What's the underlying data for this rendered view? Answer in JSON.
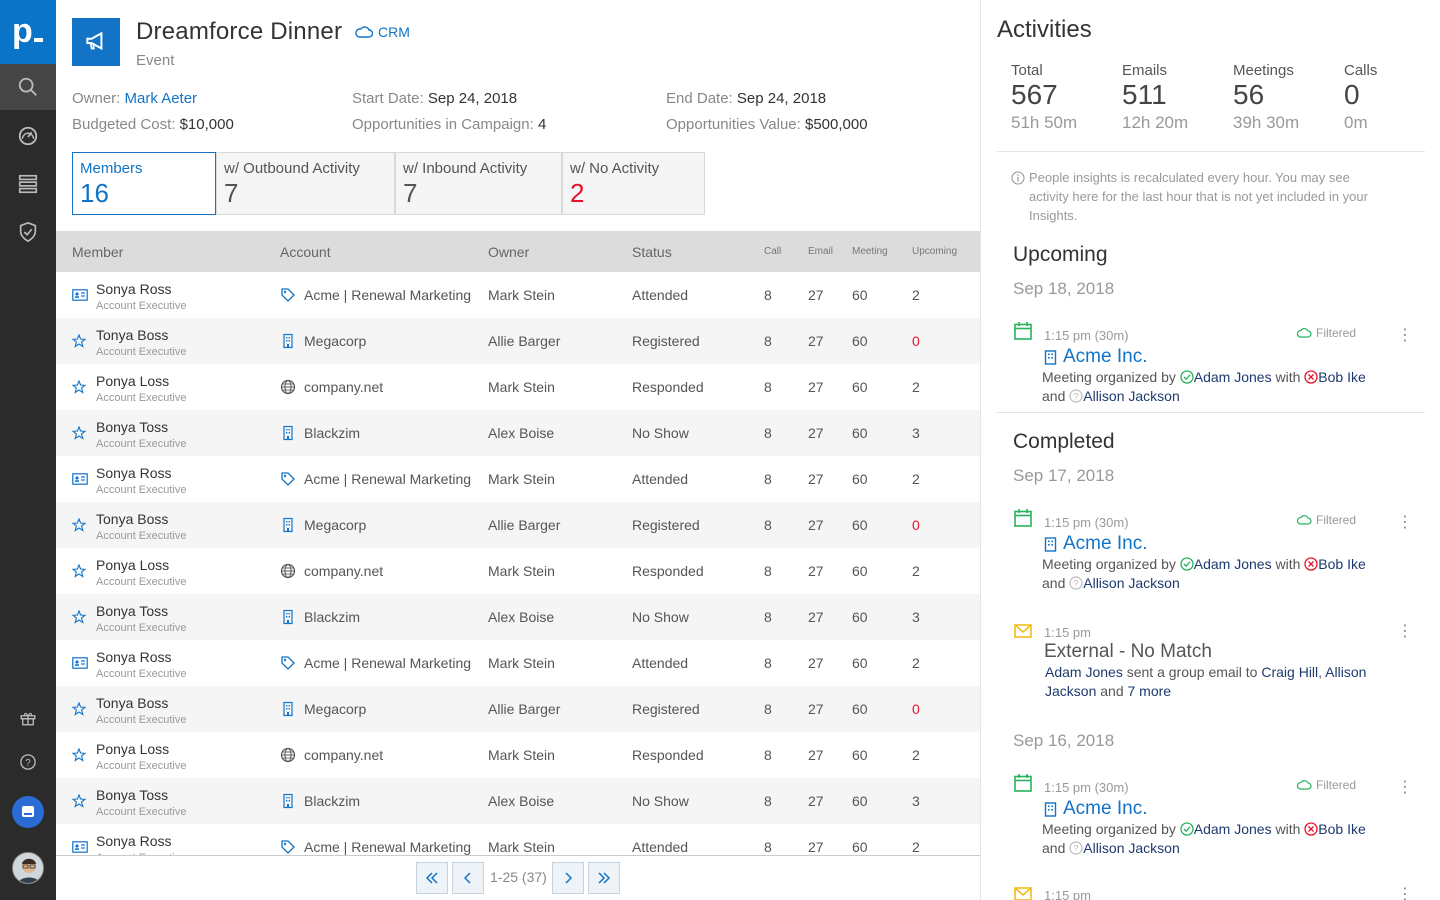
{
  "sidebar": {
    "logo": "p.",
    "items": [
      "search-icon",
      "dashboard-icon",
      "list-icon",
      "shield-icon"
    ],
    "bottom": [
      "gift-icon",
      "help-icon",
      "chat-icon",
      "avatar"
    ]
  },
  "header": {
    "title": "Dreamforce Dinner",
    "crm_label": "CRM",
    "type": "Event",
    "owner_label": "Owner:",
    "owner": "Mark Aeter",
    "budget_label": "Budgeted Cost:",
    "budget": "$10,000",
    "start_label": "Start Date:",
    "start": "Sep 24, 2018",
    "opps_label": "Opportunities in Campaign:",
    "opps": "4",
    "end_label": "End Date:",
    "end": "Sep 24, 2018",
    "oppval_label": "Opportunities Value:",
    "oppval": "$500,000"
  },
  "tabs": [
    {
      "label": "Members",
      "value": "16"
    },
    {
      "label": "w/ Outbound Activity",
      "value": "7"
    },
    {
      "label": "w/ Inbound Activity",
      "value": "7"
    },
    {
      "label": "w/ No Activity",
      "value": "2"
    }
  ],
  "table": {
    "columns": [
      "Member",
      "Account",
      "Owner",
      "Status",
      "Call",
      "Email",
      "Meeting",
      "Upcoming"
    ],
    "rows": [
      {
        "name": "Sonya Ross",
        "title": "Account Executive",
        "micon": "contact-card-icon",
        "account": "Acme | Renewal Marketing",
        "aicon": "tag-icon",
        "owner": "Mark Stein",
        "status": "Attended",
        "call": "8",
        "email": "27",
        "meeting": "60",
        "upcoming": "2"
      },
      {
        "name": "Tonya Boss",
        "title": "Account Executive",
        "micon": "star-person-icon",
        "account": "Megacorp",
        "aicon": "building-icon",
        "owner": "Allie Barger",
        "status": "Registered",
        "call": "8",
        "email": "27",
        "meeting": "60",
        "upcoming": "0"
      },
      {
        "name": "Ponya Loss",
        "title": "Account Executive",
        "micon": "star-person-icon",
        "account": "company.net",
        "aicon": "globe-icon",
        "owner": "Mark Stein",
        "status": "Responded",
        "call": "8",
        "email": "27",
        "meeting": "60",
        "upcoming": "2"
      },
      {
        "name": "Bonya Toss",
        "title": "Account Executive",
        "micon": "star-person-icon",
        "account": "Blackzim",
        "aicon": "building-icon",
        "owner": "Alex Boise",
        "status": "No Show",
        "call": "8",
        "email": "27",
        "meeting": "60",
        "upcoming": "3"
      },
      {
        "name": "Sonya Ross",
        "title": "Account Executive",
        "micon": "contact-card-icon",
        "account": "Acme | Renewal Marketing",
        "aicon": "tag-icon",
        "owner": "Mark Stein",
        "status": "Attended",
        "call": "8",
        "email": "27",
        "meeting": "60",
        "upcoming": "2"
      },
      {
        "name": "Tonya Boss",
        "title": "Account Executive",
        "micon": "star-person-icon",
        "account": "Megacorp",
        "aicon": "building-icon",
        "owner": "Allie Barger",
        "status": "Registered",
        "call": "8",
        "email": "27",
        "meeting": "60",
        "upcoming": "0"
      },
      {
        "name": "Ponya Loss",
        "title": "Account Executive",
        "micon": "star-person-icon",
        "account": "company.net",
        "aicon": "globe-icon",
        "owner": "Mark Stein",
        "status": "Responded",
        "call": "8",
        "email": "27",
        "meeting": "60",
        "upcoming": "2"
      },
      {
        "name": "Bonya Toss",
        "title": "Account Executive",
        "micon": "star-person-icon",
        "account": "Blackzim",
        "aicon": "building-icon",
        "owner": "Alex Boise",
        "status": "No Show",
        "call": "8",
        "email": "27",
        "meeting": "60",
        "upcoming": "3"
      },
      {
        "name": "Sonya Ross",
        "title": "Account Executive",
        "micon": "contact-card-icon",
        "account": "Acme | Renewal Marketing",
        "aicon": "tag-icon",
        "owner": "Mark Stein",
        "status": "Attended",
        "call": "8",
        "email": "27",
        "meeting": "60",
        "upcoming": "2"
      },
      {
        "name": "Tonya Boss",
        "title": "Account Executive",
        "micon": "star-person-icon",
        "account": "Megacorp",
        "aicon": "building-icon",
        "owner": "Allie Barger",
        "status": "Registered",
        "call": "8",
        "email": "27",
        "meeting": "60",
        "upcoming": "0"
      },
      {
        "name": "Ponya Loss",
        "title": "Account Executive",
        "micon": "star-person-icon",
        "account": "company.net",
        "aicon": "globe-icon",
        "owner": "Mark Stein",
        "status": "Responded",
        "call": "8",
        "email": "27",
        "meeting": "60",
        "upcoming": "2"
      },
      {
        "name": "Bonya Toss",
        "title": "Account Executive",
        "micon": "star-person-icon",
        "account": "Blackzim",
        "aicon": "building-icon",
        "owner": "Alex Boise",
        "status": "No Show",
        "call": "8",
        "email": "27",
        "meeting": "60",
        "upcoming": "3"
      },
      {
        "name": "Sonya Ross",
        "title": "Account Executive",
        "micon": "contact-card-icon",
        "account": "Acme | Renewal Marketing",
        "aicon": "tag-icon",
        "owner": "Mark Stein",
        "status": "Attended",
        "call": "8",
        "email": "27",
        "meeting": "60",
        "upcoming": "2"
      }
    ]
  },
  "pagination": {
    "range": "1-25 (37)"
  },
  "activities": {
    "title": "Activities",
    "stats": [
      {
        "label": "Total",
        "value": "567",
        "duration": "51h 50m"
      },
      {
        "label": "Emails",
        "value": "511",
        "duration": "12h 20m"
      },
      {
        "label": "Meetings",
        "value": "56",
        "duration": "39h 30m"
      },
      {
        "label": "Calls",
        "value": "0",
        "duration": "0m"
      }
    ],
    "insight": "People insights is recalculated every hour. You may see activity here for the last hour that is not yet included in your Insights.",
    "upcoming_heading": "Upcoming",
    "completed_heading": "Completed",
    "filtered_label": "Filtered",
    "dates": [
      "Sep 18, 2018",
      "Sep 17, 2018",
      "Sep 16, 2018"
    ],
    "meeting": {
      "time": "1:15 pm (30m)",
      "account": "Acme Inc.",
      "text1": "Meeting organized by",
      "organizer": "Adam Jones",
      "with": "with",
      "attendee": "Bob Ike",
      "and": "and",
      "attendee2": "Allison Jackson"
    },
    "email": {
      "time": "1:15 pm",
      "subject": "External - No Match",
      "sender": "Adam Jones",
      "text1": "sent a group email to",
      "to1": "Craig Hill",
      "to2": "Allison Jackson",
      "and": "and",
      "more": "7 more"
    }
  }
}
